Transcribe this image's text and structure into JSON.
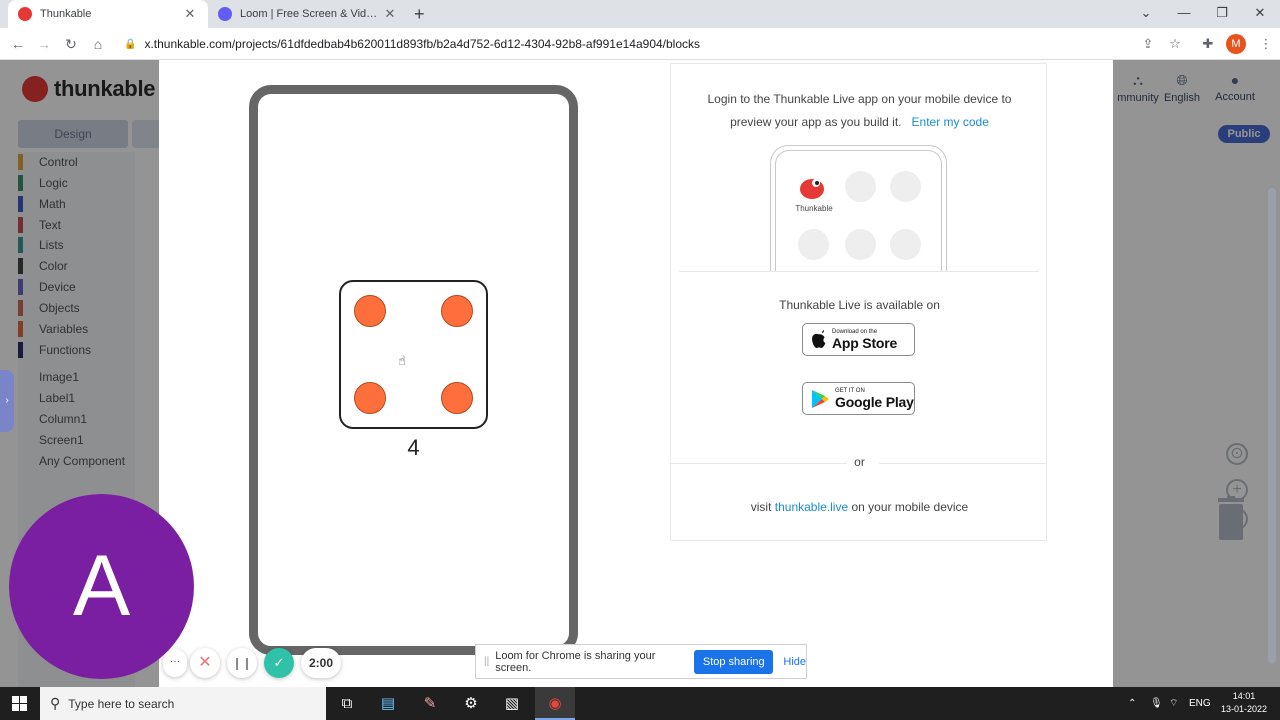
{
  "browser": {
    "tabs": [
      {
        "title": "Thunkable",
        "active": true
      },
      {
        "title": "Loom | Free Screen & Video Recording Software",
        "active": false
      }
    ],
    "url": "x.thunkable.com/projects/61dfdedbab4b620011d893fb/b2a4d752-6d12-4304-92b8-af991e14a904/blocks",
    "profile_initial": "M",
    "icons": {
      "back": "arrow-left-icon",
      "forward": "arrow-right-icon",
      "reload": "reload-icon",
      "home": "home-icon"
    }
  },
  "app": {
    "logo_text": "thunkable",
    "design_tab": "Design",
    "blocks": [
      {
        "label": "Control",
        "color": "#e0a63a"
      },
      {
        "label": "Logic",
        "color": "#3c8f6a"
      },
      {
        "label": "Math",
        "color": "#3f5cc4"
      },
      {
        "label": "Text",
        "color": "#c94e58"
      },
      {
        "label": "Lists",
        "color": "#3a9a98"
      },
      {
        "label": "Color",
        "color": "#444444"
      },
      {
        "label": "Device",
        "color": "#6b65c4"
      },
      {
        "label": "Objects",
        "color": "#cc6c5a"
      },
      {
        "label": "Variables",
        "color": "#e26a3a"
      },
      {
        "label": "Functions",
        "color": "#2c2f6a"
      }
    ],
    "components": [
      "Image1",
      "Label1",
      "Column1",
      "Screen1",
      "Any Component"
    ],
    "topnav": {
      "community": "mmunity",
      "language": "English",
      "account": "Account"
    },
    "public_badge": "Public"
  },
  "preview": {
    "die_value": "4",
    "pip_color": "#ff6f3c"
  },
  "live": {
    "instruction_line1": "Login to the Thunkable Live app on your mobile device to",
    "instruction_line2": "preview your app as you build it.",
    "enter_code": "Enter my code",
    "mini_app_label": "Thunkable",
    "available": "Thunkable Live is available on",
    "appstore_small": "Download on the",
    "appstore_big": "App Store",
    "googleplay_small": "GET IT ON",
    "googleplay_big": "Google Play",
    "or": "or",
    "visit_prefix": "visit",
    "visit_link": "thunkable.live",
    "visit_suffix": "on your mobile device"
  },
  "loom": {
    "avatar_initial": "A",
    "more": "···",
    "timer": "2:00",
    "share_text": "Loom for Chrome is sharing your screen.",
    "stop_sharing": "Stop sharing",
    "hide": "Hide"
  },
  "taskbar": {
    "search_placeholder": "Type here to search",
    "language": "ENG",
    "time": "14:01",
    "date": "13-01-2022"
  }
}
